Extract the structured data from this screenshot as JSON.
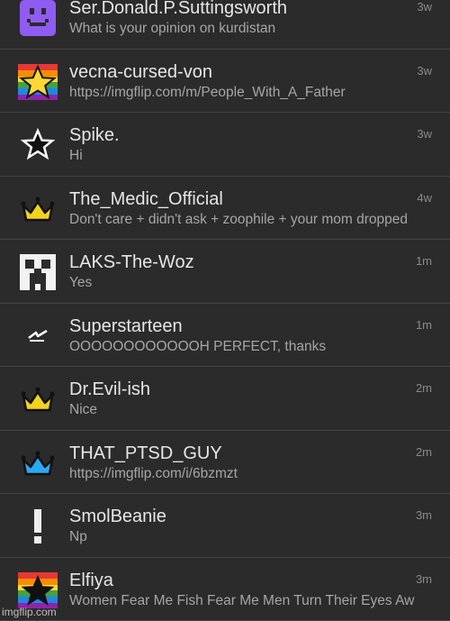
{
  "notifications": [
    {
      "name": "Ser.Donald.P.Suttingsworth",
      "message": "What is your opinion on kurdistan",
      "time": "3w",
      "icon": "purple-smiley-icon"
    },
    {
      "name": "vecna-cursed-von",
      "message": "https://imgflip.com/m/People_With_A_Father",
      "time": "3w",
      "icon": "rainbow-star-icon"
    },
    {
      "name": "Spike.",
      "message": "Hi",
      "time": "3w",
      "icon": "outline-star-icon"
    },
    {
      "name": "The_Medic_Official",
      "message": "Don't care + didn't ask + zoophile + your mom dropped",
      "time": "4w",
      "icon": "gold-crown-icon"
    },
    {
      "name": "LAKS-The-Woz",
      "message": "Yes",
      "time": "1m",
      "icon": "creeper-face-icon"
    },
    {
      "name": "Superstarteen",
      "message": "OOOOOOOOOOOOH PERFECT, thanks",
      "time": "1m",
      "icon": "slash-squiggle-icon"
    },
    {
      "name": "Dr.Evil-ish",
      "message": "Nice",
      "time": "2m",
      "icon": "gold-crown-icon"
    },
    {
      "name": "THAT_PTSD_GUY",
      "message": "https://imgflip.com/i/6bzmzt",
      "time": "2m",
      "icon": "blue-crown-icon"
    },
    {
      "name": "SmolBeanie",
      "message": "Np",
      "time": "3m",
      "icon": "exclamation-icon"
    },
    {
      "name": "Elfiya",
      "message": "Women Fear Me Fish Fear Me Men Turn Their Eyes Aw",
      "time": "3m",
      "icon": "rainbow-black-star-icon"
    }
  ],
  "watermark": "imgflip.com",
  "colors": {
    "background": "#2b2b2b",
    "divider": "#444444",
    "name": "#e6e6e6",
    "message": "#a6a6a6",
    "time": "#8a8a8a",
    "purple": "#8f5cf2",
    "gold": "#f2d21b",
    "blue": "#2ba8f5"
  }
}
